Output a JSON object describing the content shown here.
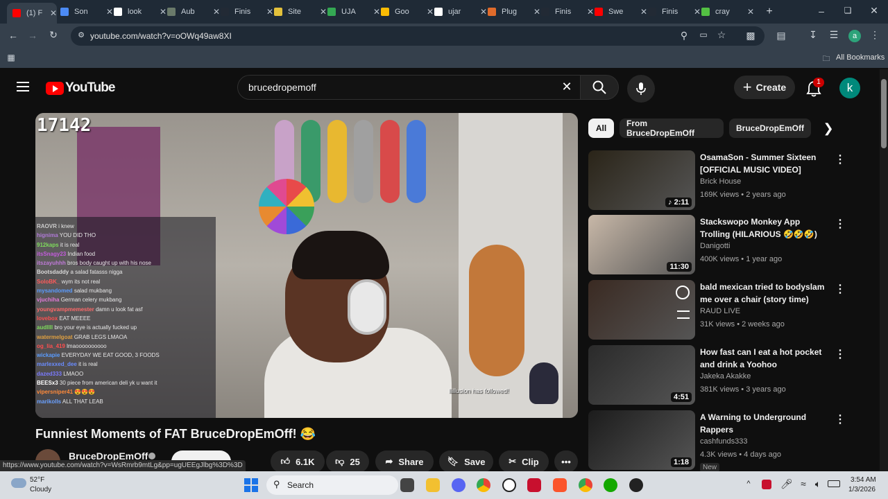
{
  "browser": {
    "tabs": [
      {
        "title": "(1) F",
        "icon": "youtube-icon",
        "color": "#ff0000"
      },
      {
        "title": "Son",
        "icon": "chrome-tab-icon",
        "color": "#4c8bf5"
      },
      {
        "title": "look",
        "icon": "google-icon",
        "color": "#ffffff"
      },
      {
        "title": "Aub",
        "icon": "doc-icon",
        "color": "#6a7a6a"
      },
      {
        "title": "Finis",
        "icon": "u-icon",
        "color": "#222a35"
      },
      {
        "title": "Site",
        "icon": "folder-icon",
        "color": "#e3c13b"
      },
      {
        "title": "UJA",
        "icon": "drive-icon",
        "color": "#34a853"
      },
      {
        "title": "Goo",
        "icon": "drive-icon",
        "color": "#fbbc04"
      },
      {
        "title": "ujar",
        "icon": "google-icon",
        "color": "#ffffff"
      },
      {
        "title": "Plug",
        "icon": "plugin-icon",
        "color": "#e06b2b"
      },
      {
        "title": "Finis",
        "icon": "u-icon",
        "color": "#222a35"
      },
      {
        "title": "Swe",
        "icon": "youtube-icon",
        "color": "#ff0000"
      },
      {
        "title": "Finis",
        "icon": "u-icon",
        "color": "#222a35"
      },
      {
        "title": "cray",
        "icon": "k-icon",
        "color": "#53c043"
      }
    ],
    "url": "youtube.com/watch?v=oOWq49aw8XI",
    "bookmarks_label": "All Bookmarks",
    "profile_initial": "a"
  },
  "youtube": {
    "logo_text": "YouTube",
    "search_value": "brucedropemoff",
    "create_label": "Create",
    "notification_count": "1",
    "avatar_initial": "k",
    "video": {
      "overlay_number": "17142",
      "follow_text": "llillusion has followed!",
      "chat": [
        {
          "user": "RAOVR",
          "msg": "i knew",
          "color": "#cccccc"
        },
        {
          "user": "hignima",
          "msg": "YOU DID THO",
          "color": "#b07ad8"
        },
        {
          "user": "912kaps",
          "msg": "it is real",
          "color": "#7fdc5c"
        },
        {
          "user": "itsSnagy23",
          "msg": "Indian food",
          "color": "#c35cdc"
        },
        {
          "user": "itszayuhhh",
          "msg": "bros body caught up with his nose",
          "color": "#c07ad8"
        },
        {
          "user": "Bootsdaddy",
          "msg": "a salad fatasss nigga",
          "color": "#d8d8d8"
        },
        {
          "user": "SoloBK_",
          "msg": "wym its not real",
          "color": "#ff5a5a"
        },
        {
          "user": "mysandomed",
          "msg": "salad mukbang",
          "color": "#5a9cff"
        },
        {
          "user": "vjuchiha",
          "msg": "German celery mukbang",
          "color": "#e07ad8"
        },
        {
          "user": "youngvampmemester",
          "msg": "damn u look fat asf",
          "color": "#ff6a6a"
        },
        {
          "user": "lovebox",
          "msg": "EAT MEEEE",
          "color": "#ff4f4f"
        },
        {
          "user": "audllll",
          "msg": "bro your eye is actually fucked up",
          "color": "#7fdc5c"
        },
        {
          "user": "watermelgoat",
          "msg": "GRAB LEGS LMAOA",
          "color": "#e0a040"
        },
        {
          "user": "og_lia_419",
          "msg": "lmaoooooooooo",
          "color": "#ff4f4f"
        },
        {
          "user": "wickapie",
          "msg": "EVERYDAY WE EAT GOOD, 3 FOODS",
          "color": "#5a9cff"
        },
        {
          "user": "marlexxed_dee",
          "msg": "it is real",
          "color": "#6a8cff"
        },
        {
          "user": "dazed333",
          "msg": "LMAOO",
          "color": "#7a7aff"
        },
        {
          "user": "BEESx3",
          "msg": "30 piece from american deli yk u want it",
          "color": "#ffffff"
        },
        {
          "user": "vipersniper41",
          "msg": "😍😍😍",
          "color": "#ff8a3a"
        },
        {
          "user": "marikolls",
          "msg": "ALL THAT LEAB",
          "color": "#6aa0ff"
        }
      ]
    },
    "title": "Funniest Moments of FAT BruceDropEmOff! 😂",
    "channel_name": "BruceDropEmOff",
    "actions": {
      "likes": "6.1K",
      "dislikes": "25",
      "share": "Share",
      "save": "Save",
      "clip": "Clip"
    },
    "chips": [
      "All",
      "From BruceDropEmOff",
      "BruceDropEmOff"
    ],
    "recommendations": [
      {
        "title": "OsamaSon - Summer Sixteen [OFFICIAL MUSIC VIDEO]",
        "channel": "Brick House",
        "meta": "169K views • 2 years ago",
        "duration": "♪ 2:11"
      },
      {
        "title": "Stackswopo Monkey App Trolling (HILARIOUS 🤣🤣🤣)",
        "channel": "Danigotti",
        "meta": "400K views • 1 year ago",
        "duration": "11:30"
      },
      {
        "title": "bald mexican tried to bodyslam me over a chair (story time)",
        "channel": "RAUD LIVE",
        "meta": "31K views • 2 weeks ago",
        "duration": ""
      },
      {
        "title": "How fast can I eat a hot pocket and drink a Yoohoo",
        "channel": "Jakeka Akakke",
        "meta": "381K views • 3 years ago",
        "duration": "4:51"
      },
      {
        "title": "A Warning to Underground Rappers",
        "channel": "cashfunds333",
        "meta": "4.3K views • 4 days ago",
        "duration": "1:18",
        "badge": "New"
      }
    ],
    "status_url": "https://www.youtube.com/watch?v=WsRmrb9mtLg&pp=ugUEEgJlbg%3D%3D"
  },
  "taskbar": {
    "temperature": "52°F",
    "weather": "Cloudy",
    "search_label": "Search",
    "time": "3:54 AM",
    "date": "1/3/2026"
  }
}
